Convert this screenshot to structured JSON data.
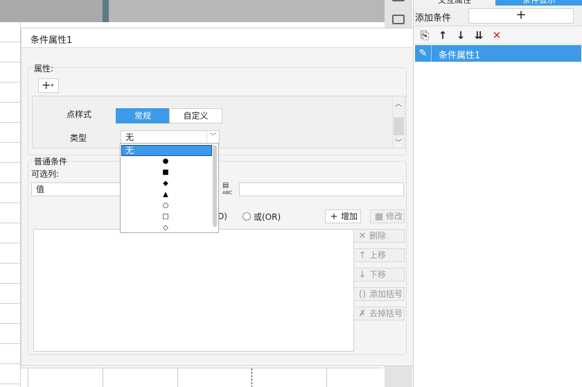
{
  "right_panel": {
    "tabs": [
      "交互属性",
      "条件显示"
    ],
    "add_condition_label": "添加条件",
    "add_icon": "+",
    "tools": {
      "copy": "⎘",
      "up": "↑",
      "down": "↓",
      "sort": "⇊",
      "delete": "✕"
    },
    "items": [
      {
        "label": "条件属性1",
        "icon": "pencil-icon"
      }
    ]
  },
  "dialog": {
    "title": "条件属性1",
    "properties_label": "属性:",
    "add_property": "+",
    "point_style_label": "点样式",
    "style_options": [
      "常规",
      "自定义"
    ],
    "type_label": "类型",
    "type_value": "无",
    "normal_conditions_label": "普通条件",
    "optional_columns_label": "可选列:",
    "column_value": "值",
    "and_label": "D)",
    "or_label": "或(OR)",
    "buttons": {
      "add": "增加",
      "edit": "修改",
      "delete": "删除",
      "move_up": "上移",
      "move_down": "下移",
      "add_bracket": "添加括号",
      "remove_bracket": "去掉括号"
    }
  },
  "type_dropdown": {
    "selected": "无",
    "options": [
      "circle",
      "square",
      "diamond",
      "triangle",
      "hollow-circle",
      "hollow-square",
      "hollow-diamond"
    ],
    "glyphs": [
      "●",
      "■",
      "◆",
      "▲",
      "○",
      "□",
      "◇"
    ]
  },
  "colors": {
    "accent": "#3d9ae8",
    "delete_red": "#e02020"
  }
}
